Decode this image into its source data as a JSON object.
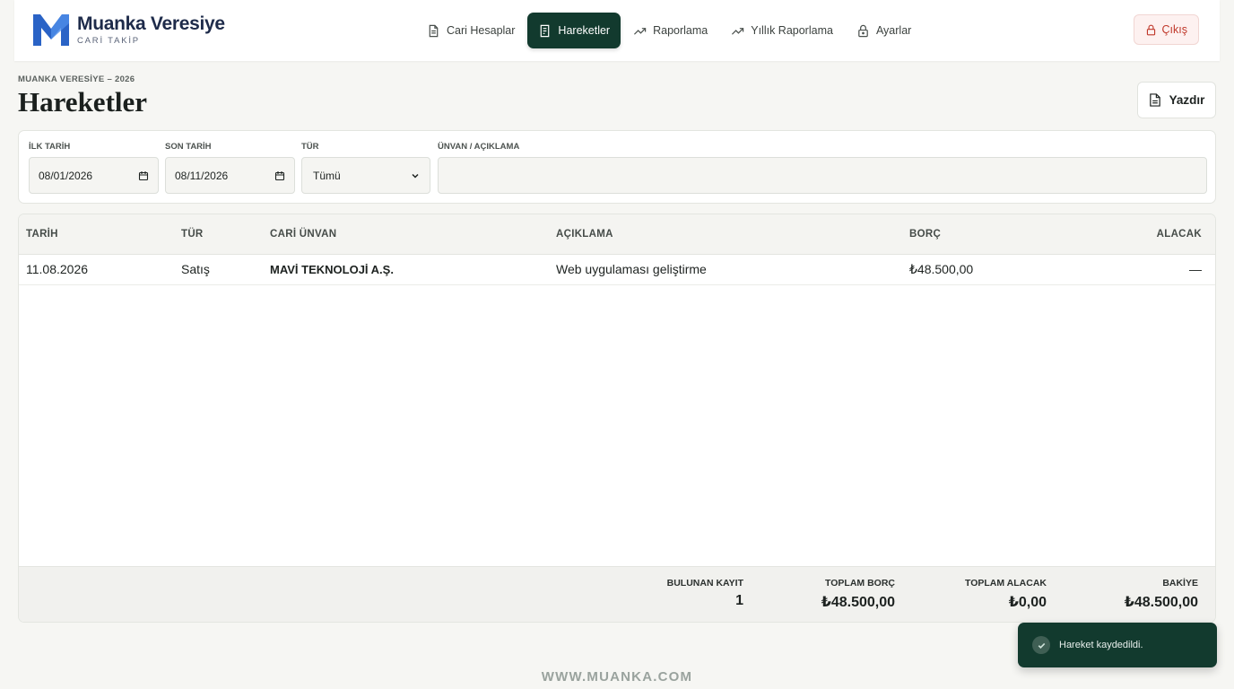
{
  "app": {
    "title": "Muanka Veresiye",
    "subtitle": "CARİ TAKİP"
  },
  "nav": {
    "items": [
      {
        "label": "Cari Hesaplar",
        "icon": "document-icon",
        "active": false
      },
      {
        "label": "Hareketler",
        "icon": "receipt-icon",
        "active": true
      },
      {
        "label": "Raporlama",
        "icon": "trending-up-icon",
        "active": false
      },
      {
        "label": "Yıllık Raporlama",
        "icon": "trending-up-icon",
        "active": false
      },
      {
        "label": "Ayarlar",
        "icon": "lock-icon",
        "active": false
      }
    ],
    "logout_label": "Çıkış"
  },
  "page": {
    "breadcrumb": "MUANKA VERESİYE – 2026",
    "title": "Hareketler",
    "print_label": "Yazdır"
  },
  "filters": {
    "start_label": "İLK TARİH",
    "start_value": "08/01/2026",
    "end_label": "SON TARİH",
    "end_value": "08/11/2026",
    "type_label": "TÜR",
    "type_value": "Tümü",
    "search_label": "ÜNVAN / AÇIKLAMA",
    "search_value": ""
  },
  "table": {
    "columns": [
      "TARİH",
      "TÜR",
      "CARİ ÜNVAN",
      "AÇIKLAMA",
      "BORÇ",
      "ALACAK"
    ],
    "rows": [
      {
        "date": "11.08.2026",
        "type": "Satış",
        "account": "MAVİ TEKNOLOJİ A.Ş.",
        "description": "Web uygulaması geliştirme",
        "debit": "₺48.500,00",
        "credit": "—"
      }
    ]
  },
  "summary": {
    "count_label": "BULUNAN KAYIT",
    "count_value": "1",
    "debit_label": "TOPLAM BORÇ",
    "debit_value": "₺48.500,00",
    "credit_label": "TOPLAM ALACAK",
    "credit_value": "₺0,00",
    "balance_label": "BAKİYE",
    "balance_value": "₺48.500,00"
  },
  "footer": {
    "site": "WWW.MUANKA.COM"
  },
  "toast": {
    "message": "Hareket kaydedildi."
  },
  "colors": {
    "accent": "#123a2e",
    "logout": "#c0392b",
    "logo_blue": "#2a63c6"
  }
}
